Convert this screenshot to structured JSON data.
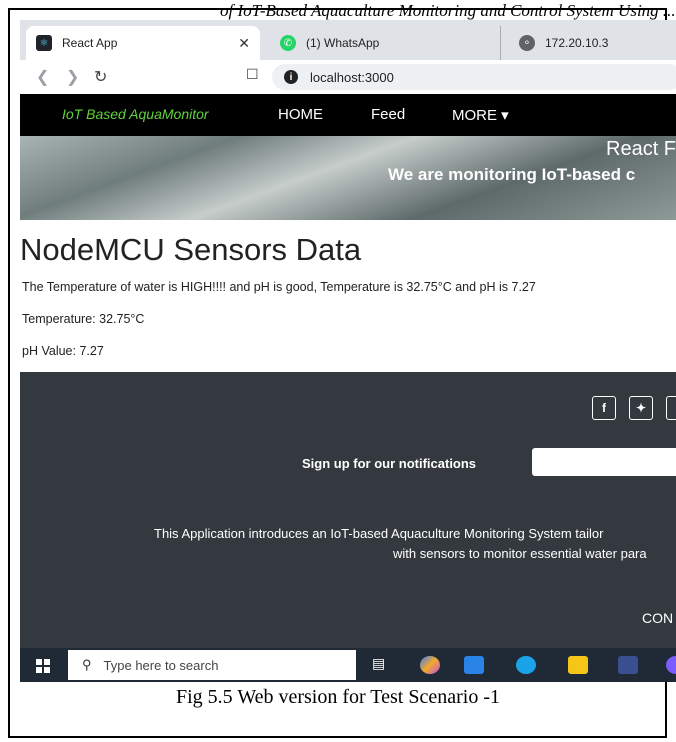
{
  "document": {
    "top_caption": "of IoT-Based Aquaculture Monitoring and Control System Using ...",
    "figure_caption": "Fig 5.5 Web version for Test Scenario -1"
  },
  "browser": {
    "tabs": [
      {
        "label": "React App",
        "icon": "react-icon"
      },
      {
        "label": "(1) WhatsApp",
        "icon": "whatsapp-icon"
      },
      {
        "label": "172.20.10.3",
        "icon": "globe-icon"
      }
    ],
    "url": "localhost:3000"
  },
  "navbar": {
    "brand": "IoT Based AquaMonitor",
    "links": [
      "HOME",
      "Feed",
      "MORE ▾"
    ]
  },
  "hero": {
    "title": "React F",
    "subtitle": "We are monitoring IoT-based c"
  },
  "main": {
    "heading": "NodeMCU Sensors Data",
    "status": "The Temperature of water is HIGH!!!! and pH is good, Temperature is 32.75°C and pH is 7.27",
    "temperature": "Temperature: 32.75°C",
    "ph": "pH Value: 7.27"
  },
  "footer": {
    "social": [
      "f",
      "t"
    ],
    "signup_label": "Sign up for our notifications",
    "email_placeholder": "",
    "about_line1": "This Application introduces an IoT-based Aquaculture Monitoring System tailor",
    "about_line2": "with sensors to monitor essential water para",
    "contact": "CON"
  },
  "taskbar": {
    "search_placeholder": "Type here to search"
  },
  "colors": {
    "brand": "#5ed43a",
    "navbar": "#000000",
    "footer": "#33393e",
    "taskbar": "#1f2a36"
  }
}
